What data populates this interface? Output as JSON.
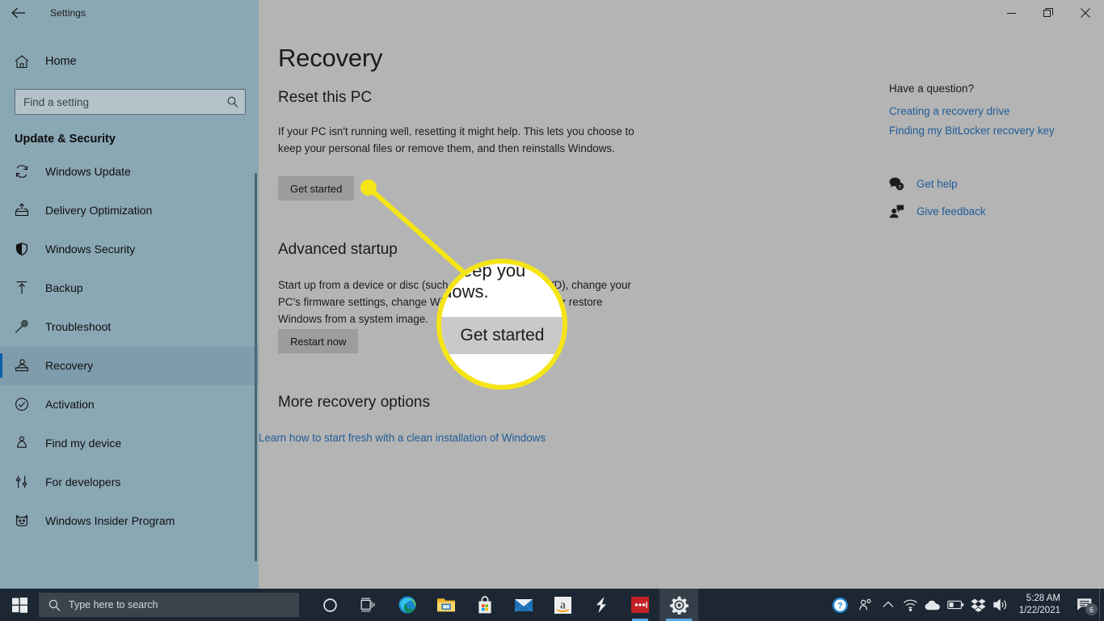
{
  "window": {
    "title": "Settings",
    "back_icon": "back-arrow-icon",
    "minimize_label": "Minimize",
    "maximize_label": "Restore",
    "close_label": "Close"
  },
  "sidebar": {
    "home_label": "Home",
    "home_icon": "home-icon",
    "search": {
      "placeholder": "Find a setting",
      "value": "",
      "icon": "search-icon"
    },
    "section_title": "Update & Security",
    "items": [
      {
        "label": "Windows Update",
        "icon": "refresh-icon",
        "selected": false
      },
      {
        "label": "Delivery Optimization",
        "icon": "upload-box-icon",
        "selected": false
      },
      {
        "label": "Windows Security",
        "icon": "shield-icon",
        "selected": false
      },
      {
        "label": "Backup",
        "icon": "upload-arrow-icon",
        "selected": false
      },
      {
        "label": "Troubleshoot",
        "icon": "wrench-icon",
        "selected": false
      },
      {
        "label": "Recovery",
        "icon": "recovery-person-icon",
        "selected": true
      },
      {
        "label": "Activation",
        "icon": "check-circle-icon",
        "selected": false
      },
      {
        "label": "Find my device",
        "icon": "person-pin-icon",
        "selected": false
      },
      {
        "label": "For developers",
        "icon": "tools-icon",
        "selected": false
      },
      {
        "label": "Windows Insider Program",
        "icon": "insider-cat-icon",
        "selected": false
      }
    ]
  },
  "main": {
    "page_title": "Recovery",
    "sections": [
      {
        "heading": "Reset this PC",
        "body": "If your PC isn't running well, resetting it might help. This lets you choose to keep your personal files or remove them, and then reinstalls Windows.",
        "button": "Get started"
      },
      {
        "heading": "Advanced startup",
        "body": "Start up from a device or disc (such as a USB drive or DVD), change your PC's firmware settings, change Windows startup settings, or restore Windows from a system image.",
        "button": "Restart now"
      },
      {
        "heading": "More recovery options",
        "link": "Learn how to start fresh with a clean installation of Windows"
      }
    ]
  },
  "help": {
    "title": "Have a question?",
    "links": [
      "Creating a recovery drive",
      "Finding my BitLocker recovery key"
    ],
    "actions": [
      {
        "label": "Get help",
        "icon": "help-chat-icon"
      },
      {
        "label": "Give feedback",
        "icon": "feedback-person-icon"
      }
    ]
  },
  "callout": {
    "magnified_line1": "eep you",
    "magnified_line2": "indows.",
    "magnified_button": "Get started",
    "accent_color": "#f5e516"
  },
  "taskbar": {
    "start_icon": "windows-start-icon",
    "search": {
      "placeholder": "Type here to search",
      "icon": "search-icon"
    },
    "icons": [
      {
        "name": "cortana-icon"
      },
      {
        "name": "task-view-icon"
      },
      {
        "name": "microsoft-edge-icon"
      },
      {
        "name": "file-explorer-icon"
      },
      {
        "name": "microsoft-store-icon"
      },
      {
        "name": "mail-icon"
      },
      {
        "name": "amazon-icon"
      },
      {
        "name": "lightning-app-icon"
      },
      {
        "name": "red-dots-app-icon"
      },
      {
        "name": "settings-gear-icon"
      }
    ],
    "tray": [
      {
        "name": "help-question-icon"
      },
      {
        "name": "people-share-icon"
      },
      {
        "name": "show-hidden-icons-chevron-icon"
      },
      {
        "name": "wifi-icon"
      },
      {
        "name": "onedrive-cloud-icon"
      },
      {
        "name": "battery-icon"
      },
      {
        "name": "dropbox-icon"
      },
      {
        "name": "volume-icon"
      }
    ],
    "clock": {
      "time": "5:28 AM",
      "date": "1/22/2021"
    },
    "notifications": {
      "icon": "action-center-icon",
      "count": "6"
    }
  }
}
